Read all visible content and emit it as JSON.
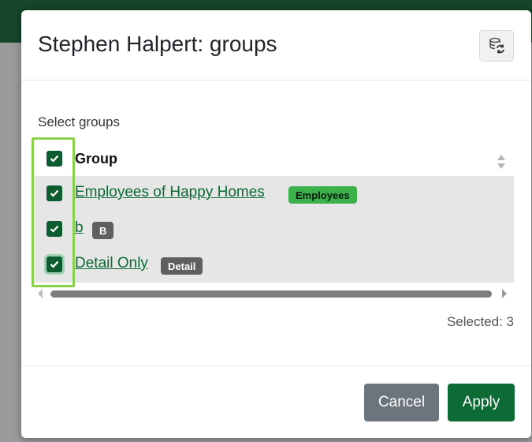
{
  "modal": {
    "title": "Stephen Halpert: groups",
    "header_button_icon": "database-refresh-icon"
  },
  "body": {
    "select_label": "Select groups",
    "grid": {
      "header_label": "Group",
      "rows": [
        {
          "name": "Employees of Happy Homes",
          "badge": "Employees",
          "badge_color": "#3cb04a",
          "checked": true
        },
        {
          "name": "b",
          "badge": "B",
          "badge_color": "#5f5f5f",
          "checked": true
        },
        {
          "name": "Detail Only",
          "badge": "Detail",
          "badge_color": "#5f5f5f",
          "checked": true
        }
      ]
    },
    "selected_text": "Selected: 3"
  },
  "footer": {
    "cancel_label": "Cancel",
    "apply_label": "Apply"
  },
  "colors": {
    "primary": "#0d6b36",
    "checkbox": "#0d5c2f",
    "highlight": "#8bd04a",
    "secondary": "#6c757d"
  }
}
